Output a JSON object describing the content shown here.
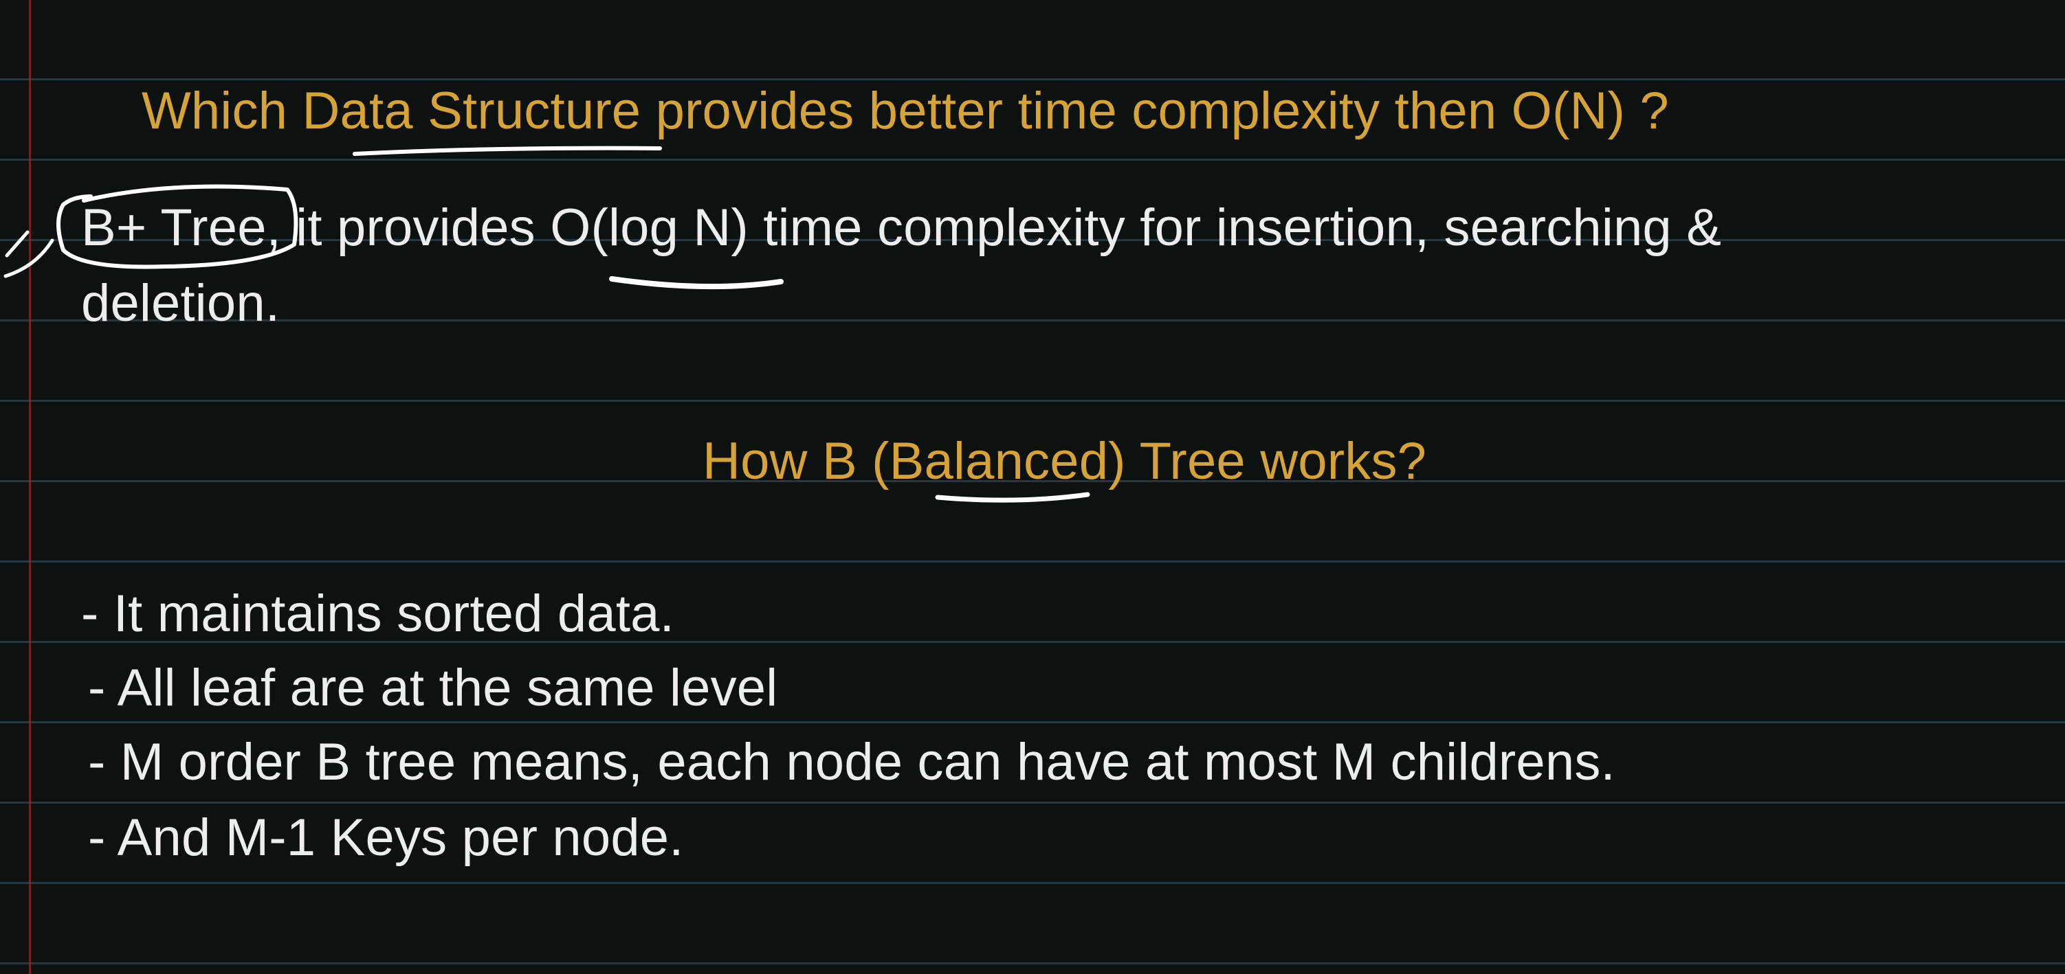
{
  "slide": {
    "question_heading": "Which Data Structure provides better time complexity then O(N) ?",
    "answer": {
      "line1": "B+ Tree, it provides O(log N) time complexity for insertion, searching &",
      "line2": "deletion."
    },
    "section_heading": "How B (Balanced) Tree works?",
    "points": [
      "- It maintains sorted data.",
      "- All leaf are at the same level",
      "- M order B tree means, each node can have at most M childrens.",
      "- And M-1 Keys per node."
    ]
  },
  "colors": {
    "background": "#0d1110",
    "heading": "#d6a334",
    "text": "#ededed",
    "rule_line": "#3a5866",
    "margin_line": "#962828",
    "ink": "#ffffff"
  }
}
